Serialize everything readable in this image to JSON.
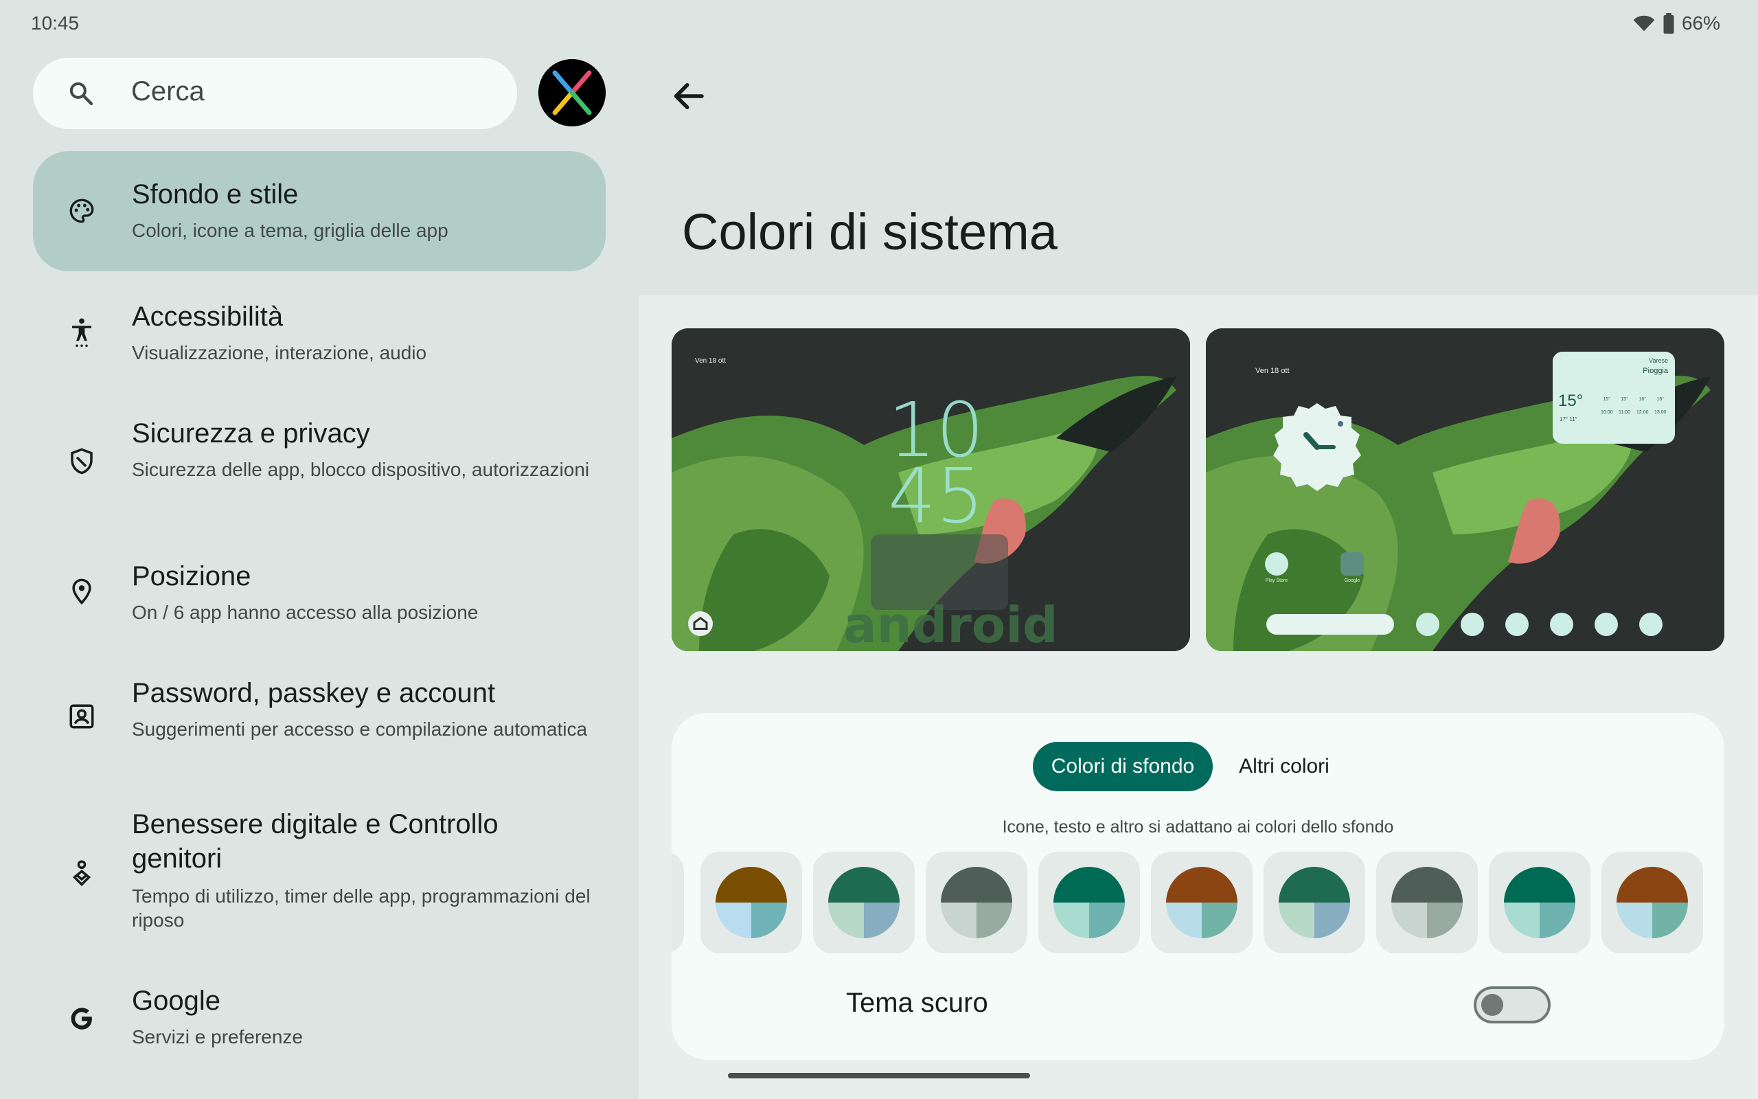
{
  "status_bar": {
    "time": "10:45",
    "battery": "66%"
  },
  "search": {
    "placeholder": "Cerca"
  },
  "menu": [
    {
      "id": "wallpaper",
      "title": "Sfondo e stile",
      "subtitle": "Colori, icone a tema, griglia delle app",
      "icon": "palette-icon",
      "active": true
    },
    {
      "id": "accessibility",
      "title": "Accessibilità",
      "subtitle": "Visualizzazione, interazione, audio",
      "icon": "accessibility-icon"
    },
    {
      "id": "security",
      "title": "Sicurezza e privacy",
      "subtitle": "Sicurezza delle app, blocco dispositivo, autorizzazioni",
      "icon": "shield-icon"
    },
    {
      "id": "location",
      "title": "Posizione",
      "subtitle": "On / 6 app hanno accesso alla posizione",
      "icon": "location-pin-icon"
    },
    {
      "id": "passwords",
      "title": "Password, passkey e account",
      "subtitle": "Suggerimenti per accesso e compilazione automatica",
      "icon": "account-box-icon"
    },
    {
      "id": "wellbeing",
      "title": "Benessere digitale e Controllo genitori",
      "subtitle": "Tempo di utilizzo, timer delle app, programmazioni del riposo",
      "icon": "wellbeing-icon"
    },
    {
      "id": "google",
      "title": "Google",
      "subtitle": "Servizi e preferenze",
      "icon": "google-icon"
    }
  ],
  "page": {
    "title": "Colori di sistema"
  },
  "previews": {
    "lock": {
      "date": "Ven 18 ott",
      "clock_hour": "10",
      "clock_min": "45",
      "watermark": "android"
    },
    "home": {
      "date": "Ven 18 ott",
      "weather": {
        "location": "Varese",
        "condition": "Pioggia",
        "temp": "15°",
        "range": "17° 11°",
        "forecast": [
          {
            "temp": "15°",
            "time": "10:00"
          },
          {
            "temp": "15°",
            "time": "11:00"
          },
          {
            "temp": "16°",
            "time": "12:00"
          },
          {
            "temp": "16°",
            "time": "13:00"
          }
        ]
      },
      "apps": [
        "Play Store",
        "Google"
      ]
    }
  },
  "palette": {
    "tabs": [
      {
        "label": "Colori di sfondo",
        "active": true
      },
      {
        "label": "Altri colori",
        "active": false
      }
    ],
    "hint": "Icone, testo e altro si adattano ai colori dello sfondo",
    "swatches": [
      {
        "top": "#7a4e00",
        "bl": "#b8dcf0",
        "br": "#6fb3b8"
      },
      {
        "top": "#1f6b52",
        "bl": "#b8d8c8",
        "br": "#86aec0"
      },
      {
        "top": "#4f5e58",
        "bl": "#c8d4d0",
        "br": "#98aaa2"
      },
      {
        "top": "#006b55",
        "bl": "#a8dcd0",
        "br": "#6fb3b0"
      },
      {
        "top": "#8b4513",
        "bl": "#b8dce8",
        "br": "#72b3a8"
      },
      {
        "top": "#1f6b52",
        "bl": "#b8d8c8",
        "br": "#86aec0"
      },
      {
        "top": "#4f5e58",
        "bl": "#c8d4d0",
        "br": "#98aaa2"
      },
      {
        "top": "#006b55",
        "bl": "#a8dcd0",
        "br": "#6fb3b0"
      },
      {
        "top": "#8b4513",
        "bl": "#b8dce8",
        "br": "#72b3a8"
      }
    ],
    "dark_theme": {
      "label": "Tema scuro",
      "enabled": false
    }
  },
  "colors": {
    "accent": "#006b5d",
    "active_item_bg": "#b2cdc5"
  }
}
